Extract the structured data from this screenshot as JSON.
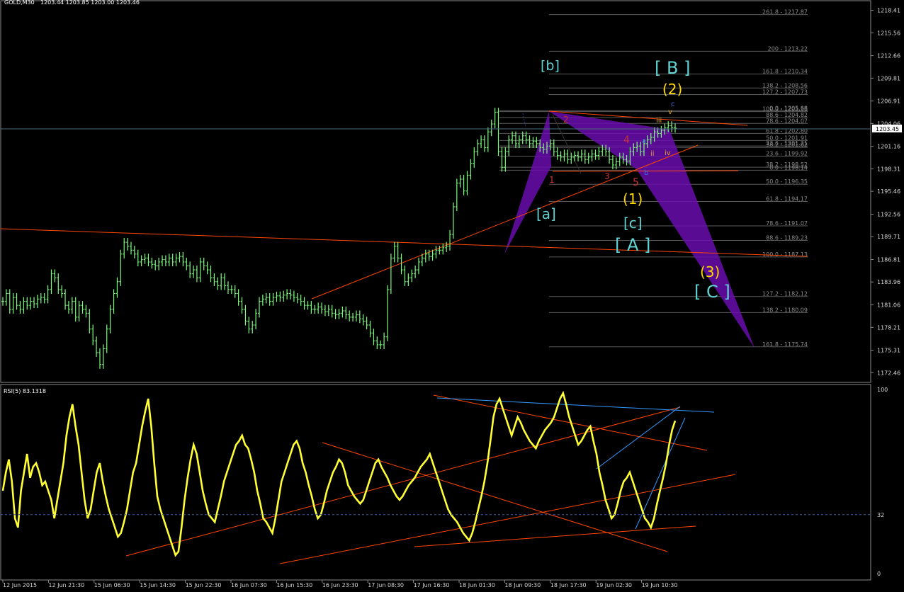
{
  "header": {
    "symbol": "GOLD,M30",
    "ohlc": "1203.44 1203.85 1203.00 1203.46"
  },
  "rsi_header": "RSI(5) 83.1318",
  "current_price_label": "1203.45",
  "colors": {
    "background": "#000000",
    "bars": "#7CFC7C",
    "rsi_line": "#FFFF33",
    "trendline": "#FF4500",
    "blue_trendline": "#1E90FF",
    "pattern_fill": "#6A0DAD",
    "fib_line": "#5a5a5a",
    "wave_cyan": "#5FD3D3",
    "wave_yellow": "#FFD700",
    "wave_red": "#CC3333",
    "wave_blue": "#3A6FE0",
    "wave_gold": "#E0A020"
  },
  "chart_data": [
    {
      "type": "candlestick",
      "title": "GOLD,M30",
      "ylim": [
        1171.5,
        1219.0
      ],
      "y_ticks": [
        "1218.41",
        "1215.56",
        "1212.66",
        "1209.81",
        "1206.91",
        "1204.06",
        "1201.16",
        "1198.31",
        "1195.46",
        "1192.56",
        "1189.71",
        "1186.81",
        "1183.96",
        "1181.06",
        "1178.21",
        "1175.31",
        "1172.46"
      ],
      "x_ticks": [
        "12 Jun 2015",
        "12 Jun 21:30",
        "15 Jun 06:30",
        "15 Jun 14:30",
        "15 Jun 22:30",
        "16 Jun 07:30",
        "16 Jun 15:30",
        "16 Jun 23:30",
        "17 Jun 08:30",
        "17 Jun 16:30",
        "18 Jun 01:30",
        "18 Jun 09:30",
        "18 Jun 17:30",
        "19 Jun 02:30",
        "19 Jun 10:30"
      ],
      "price_path": [
        1181.5,
        1182.5,
        1180.5,
        1182,
        1181,
        1180.5,
        1181.5,
        1181,
        1181.5,
        1181.2,
        1181.8,
        1182,
        1181.8,
        1183,
        1185,
        1184.5,
        1183,
        1182.5,
        1181,
        1180.5,
        1181.5,
        1179.5,
        1181,
        1180.5,
        1180,
        1178,
        1176.5,
        1175,
        1173.5,
        1175.5,
        1178,
        1180.5,
        1182.5,
        1184,
        1187.5,
        1189,
        1188.5,
        1188,
        1187.5,
        1186.5,
        1186.8,
        1187,
        1186.5,
        1186.2,
        1186,
        1186.5,
        1186.8,
        1186.5,
        1187,
        1186.5,
        1187,
        1187.2,
        1186.5,
        1186,
        1185,
        1185.5,
        1184.5,
        1186.5,
        1186,
        1185.5,
        1184.5,
        1184,
        1183.5,
        1184.5,
        1183.5,
        1183,
        1183,
        1182.5,
        1181.5,
        1180.5,
        1179,
        1178,
        1178.5,
        1180,
        1181.5,
        1181.8,
        1182,
        1181.5,
        1182,
        1182.2,
        1182,
        1182.3,
        1182.5,
        1182.3,
        1182,
        1181.8,
        1181.5,
        1181,
        1181,
        1180.5,
        1180.5,
        1180.8,
        1180.5,
        1180.2,
        1180.5,
        1180,
        1179.8,
        1180,
        1180.3,
        1179.8,
        1179.5,
        1179.5,
        1179.8,
        1179.3,
        1179,
        1178.5,
        1177.5,
        1176.5,
        1176,
        1176,
        1177,
        1183,
        1187,
        1188.5,
        1187,
        1185.5,
        1184,
        1184.5,
        1185,
        1185.5,
        1186.5,
        1187,
        1187.5,
        1187.2,
        1187.5,
        1188,
        1188,
        1188.3,
        1188.5,
        1190,
        1193.5,
        1196.5,
        1197,
        1195.5,
        1197.5,
        1199,
        1200.5,
        1201.5,
        1202,
        1201,
        1203,
        1204,
        1205.5,
        1200.5,
        1198.5,
        1200.5,
        1202,
        1202.5,
        1201.5,
        1202,
        1202.5,
        1202,
        1201.5,
        1201.8,
        1201.5,
        1201,
        1200.8,
        1201.2,
        1201.5,
        1200.5,
        1200,
        1199.8,
        1200.2,
        1199.5,
        1199.8,
        1200,
        1199.8,
        1200.2,
        1199.5,
        1199.8,
        1200.2,
        1200,
        1200.5,
        1200.8,
        1200.5,
        1199.5,
        1198.8,
        1199.2,
        1199.8,
        1199.5,
        1199.3,
        1200.5,
        1201,
        1201.2,
        1200.5,
        1201.5,
        1202,
        1202.3,
        1203,
        1202.8,
        1203.2,
        1203.5,
        1203.8,
        1203.5,
        1203.46
      ]
    },
    {
      "type": "line",
      "title": "RSI(5) 83.1318",
      "ylim": [
        0,
        100
      ],
      "y_ticks": [
        "100",
        "32",
        "0"
      ],
      "series": [
        {
          "values": [
            45,
            55,
            62,
            50,
            30,
            25,
            45,
            55,
            65,
            52,
            58,
            60,
            55,
            48,
            50,
            45,
            40,
            30,
            40,
            50,
            60,
            75,
            85,
            92,
            80,
            70,
            55,
            40,
            30,
            35,
            45,
            55,
            60,
            50,
            42,
            35,
            30,
            25,
            20,
            22,
            28,
            35,
            45,
            55,
            60,
            70,
            80,
            88,
            95,
            80,
            60,
            42,
            35,
            30,
            25,
            20,
            15,
            10,
            12,
            25,
            40,
            52,
            62,
            70,
            65,
            55,
            45,
            38,
            32,
            30,
            28,
            35,
            42,
            50,
            55,
            60,
            65,
            70,
            72,
            75,
            70,
            68,
            62,
            55,
            45,
            38,
            30,
            28,
            25,
            22,
            30,
            40,
            50,
            55,
            60,
            65,
            70,
            72,
            68,
            60,
            55,
            48,
            42,
            35,
            30,
            32,
            38,
            45,
            50,
            55,
            58,
            62,
            60,
            55,
            48,
            45,
            42,
            40,
            38,
            40,
            45,
            50,
            55,
            60,
            62,
            58,
            55,
            52,
            48,
            45,
            42,
            40,
            42,
            45,
            48,
            50,
            52,
            55,
            58,
            60,
            62,
            65,
            60,
            55,
            50,
            45,
            40,
            35,
            32,
            30,
            28,
            25,
            22,
            20,
            18,
            22,
            28,
            35,
            42,
            50,
            60,
            72,
            85,
            92,
            95,
            90,
            85,
            80,
            75,
            80,
            85,
            82,
            78,
            75,
            72,
            70,
            68,
            72,
            75,
            78,
            80,
            82,
            85,
            90,
            95,
            98,
            92,
            85,
            80,
            75,
            70,
            72,
            75,
            78,
            80,
            72,
            65,
            55,
            48,
            40,
            35,
            30,
            32,
            38,
            45,
            50,
            52,
            55,
            50,
            45,
            40,
            35,
            30,
            28,
            25,
            30,
            38,
            45,
            52,
            60,
            70,
            78,
            83
          ]
        }
      ]
    }
  ],
  "fib_labels": [
    {
      "text": "261.8 - 1217.87",
      "price": 1217.87
    },
    {
      "text": "200 - 1213.22",
      "price": 1213.22
    },
    {
      "text": "161.8 - 1210.34",
      "price": 1210.34
    },
    {
      "text": "138.2 - 1208.56",
      "price": 1208.56
    },
    {
      "text": "127.2 - 1207.73",
      "price": 1207.73
    },
    {
      "text": "0.0 - 1205.68",
      "price": 1205.68
    },
    {
      "text": "100.0 - 1205.56",
      "price": 1205.56
    },
    {
      "text": "88.6 - 1204.82",
      "price": 1204.82
    },
    {
      "text": "78.6 - 1204.07",
      "price": 1204.07
    },
    {
      "text": "61.8 - 1202.80",
      "price": 1202.8
    },
    {
      "text": "50.0 - 1201.91",
      "price": 1201.91
    },
    {
      "text": "23.6 - 1201.21",
      "price": 1201.21
    },
    {
      "text": "38.2 - 1201.02",
      "price": 1201.02
    },
    {
      "text": "23.6 - 1199.92",
      "price": 1199.92
    },
    {
      "text": "38.2 - 1198.52",
      "price": 1198.52
    },
    {
      "text": "0.0 - 1198.14",
      "price": 1198.14
    },
    {
      "text": "50.0 - 1196.35",
      "price": 1196.35
    },
    {
      "text": "61.8 - 1194.17",
      "price": 1194.17
    },
    {
      "text": "78.6 - 1191.07",
      "price": 1191.07
    },
    {
      "text": "88.6 - 1189.23",
      "price": 1189.23
    },
    {
      "text": "100.0 - 1187.13",
      "price": 1187.13
    },
    {
      "text": "127.2 - 1182.12",
      "price": 1182.12
    },
    {
      "text": "138.2 - 1180.09",
      "price": 1180.09
    },
    {
      "text": "161.8 - 1175.74",
      "price": 1175.74
    }
  ],
  "wave_labels": [
    {
      "text": "[b]",
      "color": "cyan"
    },
    {
      "text": "[ B ]",
      "color": "cyan"
    },
    {
      "text": "(2)",
      "color": "yellow"
    },
    {
      "text": "c",
      "color": "blue"
    },
    {
      "text": "v",
      "color": "gold"
    },
    {
      "text": "iii",
      "color": "gold"
    },
    {
      "text": "iv",
      "color": "gold"
    },
    {
      "text": "ii",
      "color": "gold"
    },
    {
      "text": "a",
      "color": "blue"
    },
    {
      "text": "b",
      "color": "blue"
    },
    {
      "text": "2",
      "color": "red"
    },
    {
      "text": "4",
      "color": "red"
    },
    {
      "text": "1",
      "color": "red"
    },
    {
      "text": "3",
      "color": "red"
    },
    {
      "text": "5",
      "color": "red"
    },
    {
      "text": "(1)",
      "color": "yellow"
    },
    {
      "text": "[c]",
      "color": "cyan"
    },
    {
      "text": "[ A ]",
      "color": "cyan"
    },
    {
      "text": "[a]",
      "color": "cyan"
    },
    {
      "text": "(3)",
      "color": "yellow"
    },
    {
      "text": "[ C ]",
      "color": "cyan"
    }
  ]
}
